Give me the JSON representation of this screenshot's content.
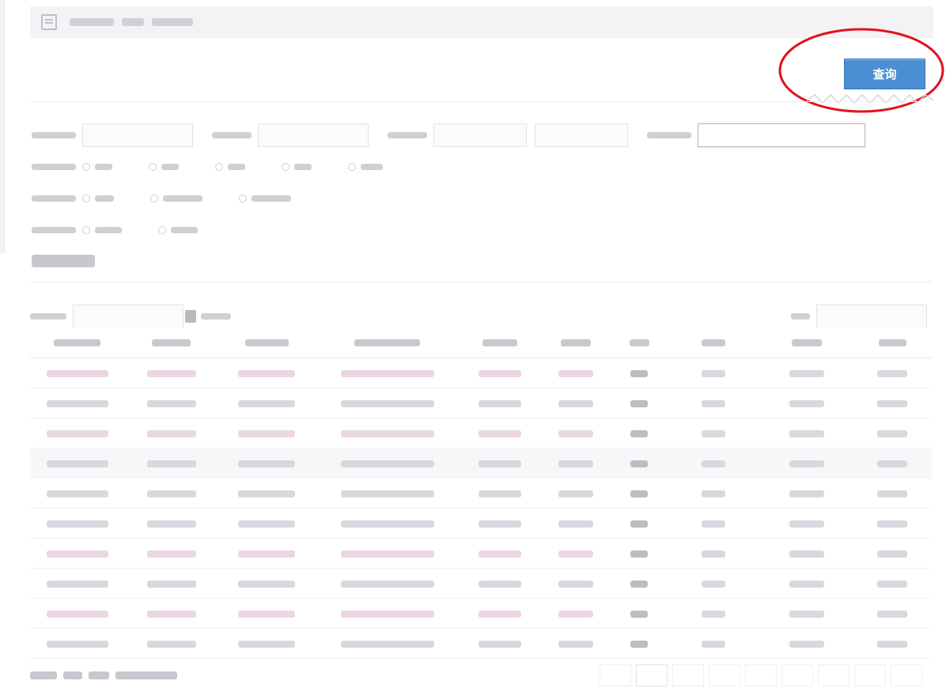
{
  "toolbar": {
    "query_label": "查询"
  },
  "colors": {
    "query_button_bg": "#4a8fd3",
    "annotation_stroke": "#e0141e",
    "breadcrumb_bg": "#f5f2f5"
  },
  "icons": {
    "breadcrumb": "list-icon",
    "table_search": "search-icon"
  }
}
